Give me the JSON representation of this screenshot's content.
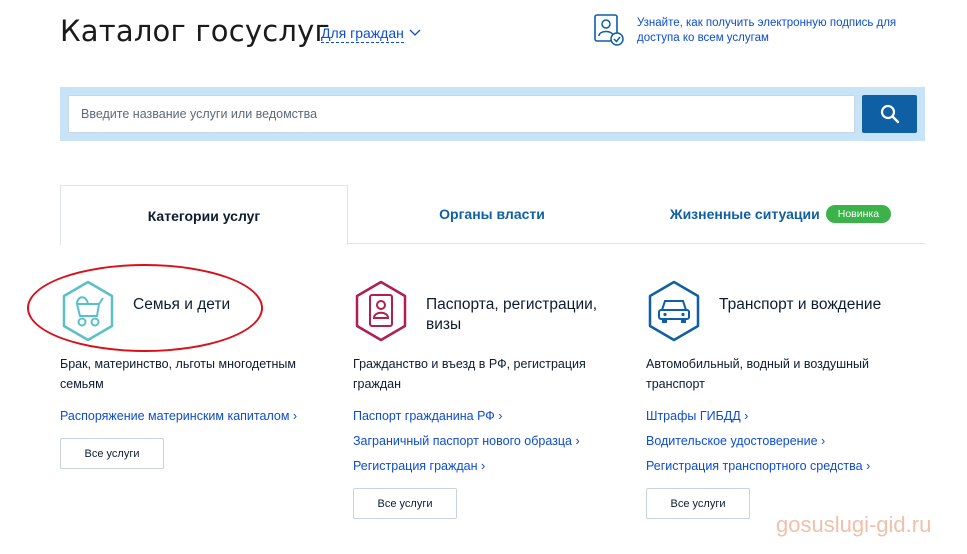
{
  "header": {
    "title": "Каталог госуслуг",
    "audience": "Для граждан",
    "esig_text": "Узнайте, как получить электронную подпись для доступа ко всем услугам"
  },
  "search": {
    "placeholder": "Введите название услуги или ведомства",
    "button_icon": "search-icon"
  },
  "tabs": [
    {
      "label": "Категории услуг",
      "active": true
    },
    {
      "label": "Органы власти",
      "active": false
    },
    {
      "label": "Жизненные ситуации",
      "active": false,
      "badge": "Новинка"
    }
  ],
  "categories": [
    {
      "icon": "baby-carriage-icon",
      "title": "Семья и дети",
      "description": "Брак, материнство, льготы многодетным семьям",
      "links": [
        "Распоряжение материнским капиталом ›"
      ],
      "all_label": "Все услуги"
    },
    {
      "icon": "passport-icon",
      "title": "Паспорта, регистрации, визы",
      "description": "Гражданство и въезд в РФ, регистрация граждан",
      "links": [
        "Паспорт гражданина РФ ›",
        "Заграничный паспорт нового образца ›",
        "Регистрация граждан ›"
      ],
      "all_label": "Все услуги"
    },
    {
      "icon": "car-icon",
      "title": "Транспорт и вождение",
      "description": "Автомобильный, водный и воздушный транспорт",
      "links": [
        "Штрафы ГИБДД ›",
        "Водительское удостоверение ›",
        "Регистрация транспортного средства ›"
      ],
      "all_label": "Все услуги"
    }
  ],
  "watermark": "gosuslugi-gid.ru",
  "colors": {
    "accent": "#0d4cd3",
    "button": "#0f5fa5",
    "family": "#5bbfc8",
    "passport": "#b01f4e",
    "transport": "#0f5fa5",
    "badge": "#3bb34a",
    "highlight": "#d9101b"
  }
}
